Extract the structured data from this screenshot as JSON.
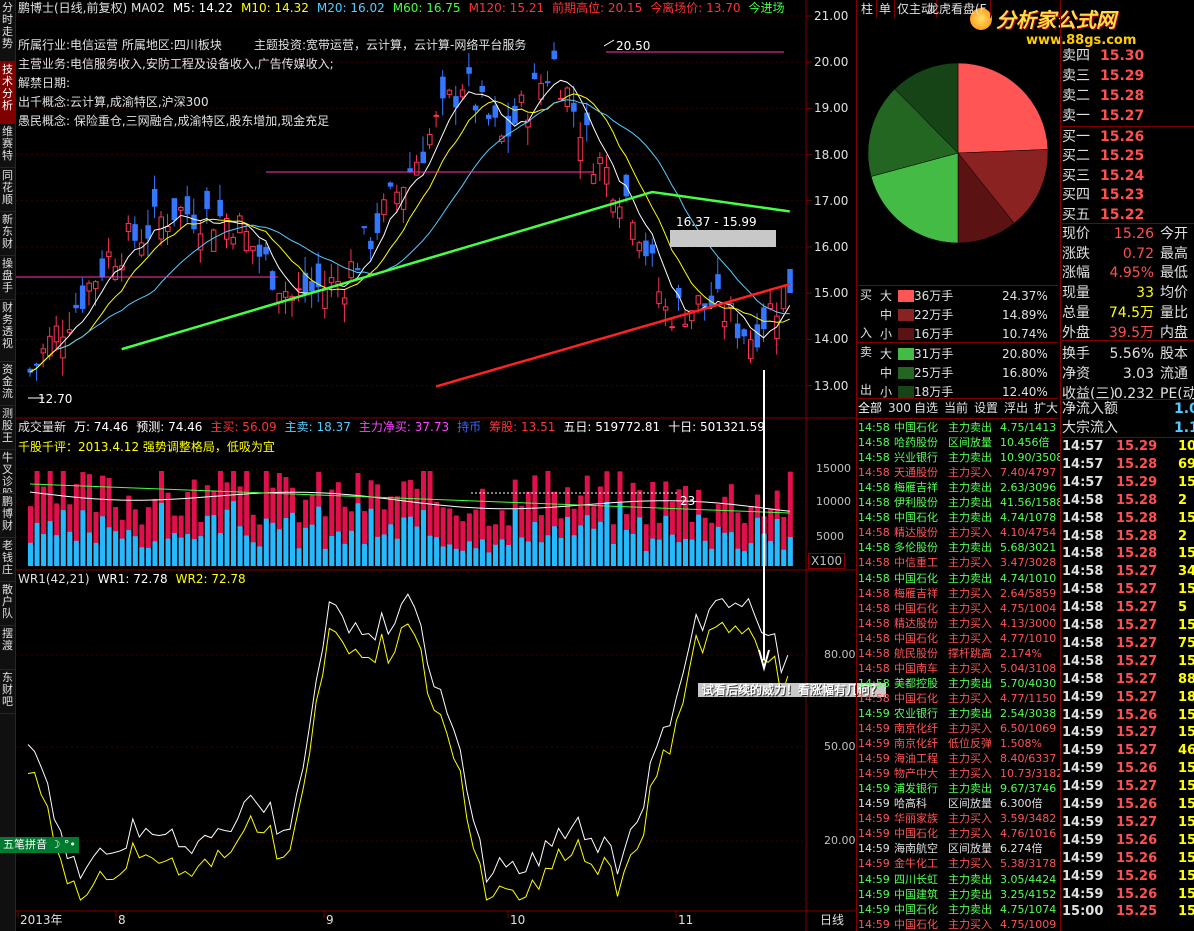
{
  "title_bar": {
    "items": [
      {
        "text": "鹏博士(日线,前复权) MA02",
        "color": "#e0e0e0"
      },
      {
        "text": "M5: 14.22",
        "color": "#ffffff"
      },
      {
        "text": "M10: 14.32",
        "color": "#ffff00"
      },
      {
        "text": "M20: 16.02",
        "color": "#55ccff"
      },
      {
        "text": "M60: 16.75",
        "color": "#44ff44"
      },
      {
        "text": "M120: 15.21",
        "color": "#ff3333"
      },
      {
        "text": "前期高位: 20.15",
        "color": "#ff3333"
      },
      {
        "text": "今离场价: 13.70",
        "color": "#ff3333"
      },
      {
        "text": "今进场",
        "color": "#44ff44"
      }
    ]
  },
  "info_lines": [
    "所属行业:电信运营 所属地区:四川板块",
    "主题投资:宽带运营，云计算，云计算-网络平台服务",
    "主营业务:电信服务收入,安防工程及设备收入,广告传媒收入;",
    "解禁日期:",
    "出千概念:云计算,成渝特区,沪深300",
    "愚民概念: 保险重仓,三网融合,成渝特区,股东增加,现金充足"
  ],
  "left_tabs": [
    "分时走势",
    "技术分析",
    "维赛特",
    "同花顺",
    "新东财",
    "操盘手",
    "财务透视",
    "资金流",
    "测股王",
    "牛叉诊股",
    "鹏博财",
    "老钱庄",
    "散户队",
    "摆渡",
    "东财吧"
  ],
  "price_axis": [
    "21.00",
    "20.00",
    "19.00",
    "18.00",
    "17.00",
    "16.00",
    "15.00",
    "14.00",
    "13.00"
  ],
  "price_annotations": {
    "high": "20.50",
    "low": "12.70",
    "range": "16.37 - 15.99"
  },
  "volume_title": [
    {
      "text": "成交量新",
      "color": "#e0e0e0"
    },
    {
      "text": "万: 74.46",
      "color": "#ffffff"
    },
    {
      "text": "预测: 74.46",
      "color": "#ffffff"
    },
    {
      "text": "主买: 56.09",
      "color": "#ff3333"
    },
    {
      "text": "主卖: 18.37",
      "color": "#55ccff"
    },
    {
      "text": "主力净买: 37.73",
      "color": "#ff44ff"
    },
    {
      "text": "持币",
      "color": "#3366ff"
    },
    {
      "text": "筹股: 13.51",
      "color": "#ff3333"
    },
    {
      "text": "五日: 519772.81",
      "color": "#ffffff"
    },
    {
      "text": "十日: 501321.59",
      "color": "#ffffff"
    }
  ],
  "volume_comment": "千股千评：2013.4.12 强势调整格局，低吸为宜",
  "volume_axis": [
    "15000",
    "10000",
    "5000"
  ],
  "volume_unit": "X100",
  "volume_marker": "23",
  "wr_title": [
    {
      "text": "WR1(42,21)",
      "color": "#e0e0e0"
    },
    {
      "text": "WR1: 72.78",
      "color": "#ffffff"
    },
    {
      "text": "WR2: 72.78",
      "color": "#ffff00"
    }
  ],
  "wr_axis": [
    "80.00",
    "50.00",
    "20.00"
  ],
  "annotation_text": "试看后续的威力！看涨幅有几何？",
  "ime_label": "五笔拼音",
  "x_axis": [
    "2013年",
    "8",
    "9",
    "10",
    "11"
  ],
  "period": "日线",
  "watermark": {
    "brand": "分析家公式网",
    "url": "www.88gs.com"
  },
  "right_tabs": [
    "柱",
    "单",
    "仅主动",
    "龙虎看盘(F"
  ],
  "pie": {
    "segments": [
      {
        "label": "买大",
        "value": 24.37,
        "color": "#ff5555"
      },
      {
        "label": "买中",
        "value": 14.89,
        "color": "#8b2222"
      },
      {
        "label": "买小",
        "value": 10.74,
        "color": "#5a1212"
      },
      {
        "label": "卖大",
        "value": 20.8,
        "color": "#44bb44"
      },
      {
        "label": "卖中",
        "value": 16.8,
        "color": "#226622"
      },
      {
        "label": "卖小",
        "value": 12.4,
        "color": "#174417"
      }
    ]
  },
  "flow_table": {
    "buy_label": [
      "买",
      "入"
    ],
    "sell_label": [
      "卖",
      "出"
    ],
    "rows": [
      {
        "size": "大",
        "amount": "36万手",
        "pct": "24.37%",
        "color": "#ff5555"
      },
      {
        "size": "中",
        "amount": "22万手",
        "pct": "14.89%",
        "color": "#8b2222"
      },
      {
        "size": "小",
        "amount": "16万手",
        "pct": "10.74%",
        "color": "#5a1212"
      },
      {
        "size": "大",
        "amount": "31万手",
        "pct": "20.80%",
        "color": "#44bb44"
      },
      {
        "size": "中",
        "amount": "25万手",
        "pct": "16.80%",
        "color": "#226622"
      },
      {
        "size": "小",
        "amount": "18万手",
        "pct": "12.40%",
        "color": "#174417"
      }
    ]
  },
  "bottom_tabs": [
    "全部",
    "300",
    "自选",
    "当前",
    "设置",
    "浮出",
    "扩大"
  ],
  "order_book": {
    "asks": [
      {
        "label": "卖四",
        "price": "15.30",
        "vol": ""
      },
      {
        "label": "卖三",
        "price": "15.29",
        "vol": ""
      },
      {
        "label": "卖二",
        "price": "15.28",
        "vol": ""
      },
      {
        "label": "卖一",
        "price": "15.27",
        "vol": ""
      }
    ],
    "bids": [
      {
        "label": "买一",
        "price": "15.26",
        "vol": ""
      },
      {
        "label": "买二",
        "price": "15.25",
        "vol": ""
      },
      {
        "label": "买三",
        "price": "15.24",
        "vol": ""
      },
      {
        "label": "买四",
        "price": "15.23",
        "vol": ""
      },
      {
        "label": "买五",
        "price": "15.22",
        "vol": ""
      }
    ]
  },
  "quote": [
    {
      "l": "现价",
      "v": "15.26",
      "vc": "#ff5050",
      "l2": "今开"
    },
    {
      "l": "涨跌",
      "v": "0.72",
      "vc": "#ff5050",
      "l2": "最高"
    },
    {
      "l": "涨幅",
      "v": "4.95%",
      "vc": "#ff5050",
      "l2": "最低"
    },
    {
      "l": "现量",
      "v": "33",
      "vc": "#ffff00",
      "l2": "均价"
    },
    {
      "l": "总量",
      "v": "74.5万",
      "vc": "#ffff00",
      "l2": "量比"
    },
    {
      "l": "外盘",
      "v": "39.5万",
      "vc": "#ff5050",
      "l2": "内盘"
    },
    {
      "l": "换手",
      "v": "5.56%",
      "vc": "#e0e0e0",
      "l2": "股本"
    },
    {
      "l": "净资",
      "v": "3.03",
      "vc": "#e0e0e0",
      "l2": "流通"
    },
    {
      "l": "收益(三)",
      "v": "0.232",
      "vc": "#e0e0e0",
      "l2": "PE(动"
    }
  ],
  "fund_flow": [
    {
      "label": "净流入额",
      "value": "1.0",
      "color": "#55ccff"
    },
    {
      "label": "大宗流入",
      "value": "1.1",
      "color": "#55ccff"
    }
  ],
  "ticker": [
    {
      "t": "14:58",
      "name": "中国石化",
      "act": "主力卖出",
      "num": "4.75/1413",
      "c": "#55ff55"
    },
    {
      "t": "14:58",
      "name": "哈药股份",
      "act": "区间放量",
      "num": "10.456倍",
      "c": "#55ff55"
    },
    {
      "t": "14:58",
      "name": "兴业银行",
      "act": "主力卖出",
      "num": "10.90/3508",
      "c": "#55ff55"
    },
    {
      "t": "14:58",
      "name": "天通股份",
      "act": "主力买入",
      "num": "7.40/4797",
      "c": "#ff5555"
    },
    {
      "t": "14:58",
      "name": "梅雁吉祥",
      "act": "主力卖出",
      "num": "2.63/3096",
      "c": "#55ff55"
    },
    {
      "t": "14:58",
      "name": "伊利股份",
      "act": "主力卖出",
      "num": "41.56/1588",
      "c": "#55ff55"
    },
    {
      "t": "14:58",
      "name": "中国石化",
      "act": "主力卖出",
      "num": "4.74/1078",
      "c": "#55ff55"
    },
    {
      "t": "14:58",
      "name": "精达股份",
      "act": "主力买入",
      "num": "4.10/4754",
      "c": "#ff5555"
    },
    {
      "t": "14:58",
      "name": "多伦股份",
      "act": "主力卖出",
      "num": "5.68/3021",
      "c": "#55ff55"
    },
    {
      "t": "14:58",
      "name": "中信重工",
      "act": "主力买入",
      "num": "3.47/3028",
      "c": "#ff5555"
    },
    {
      "t": "14:58",
      "name": "中国石化",
      "act": "主力卖出",
      "num": "4.74/1010",
      "c": "#55ff55"
    },
    {
      "t": "14:58",
      "name": "梅雁吉祥",
      "act": "主力买入",
      "num": "2.64/5859",
      "c": "#ff5555"
    },
    {
      "t": "14:58",
      "name": "中国石化",
      "act": "主力买入",
      "num": "4.75/1004",
      "c": "#ff5555"
    },
    {
      "t": "14:58",
      "name": "精达股份",
      "act": "主力买入",
      "num": "4.13/3000",
      "c": "#ff5555"
    },
    {
      "t": "14:58",
      "name": "中国石化",
      "act": "主力买入",
      "num": "4.77/1010",
      "c": "#ff5555"
    },
    {
      "t": "14:58",
      "name": "航民股份",
      "act": "撑杆跳高",
      "num": "2.174%",
      "c": "#ff5555"
    },
    {
      "t": "14:58",
      "name": "中国南车",
      "act": "主力买入",
      "num": "5.04/3108",
      "c": "#ff5555"
    },
    {
      "t": "14:58",
      "name": "美都控股",
      "act": "主力卖出",
      "num": "5.70/4030",
      "c": "#55ff55"
    },
    {
      "t": "14:58",
      "name": "中国石化",
      "act": "主力买入",
      "num": "4.77/1150",
      "c": "#ff5555"
    },
    {
      "t": "14:59",
      "name": "农业银行",
      "act": "主力卖出",
      "num": "2.54/3038",
      "c": "#55ff55"
    },
    {
      "t": "14:59",
      "name": "南京化纤",
      "act": "主力买入",
      "num": "6.50/1069",
      "c": "#ff5555"
    },
    {
      "t": "14:59",
      "name": "南京化纤",
      "act": "低位反弹",
      "num": "1.508%",
      "c": "#ff5555"
    },
    {
      "t": "14:59",
      "name": "海油工程",
      "act": "主力买入",
      "num": "8.40/6337",
      "c": "#ff5555"
    },
    {
      "t": "14:59",
      "name": "物产中大",
      "act": "主力买入",
      "num": "10.73/3182",
      "c": "#ff5555"
    },
    {
      "t": "14:59",
      "name": "浦发银行",
      "act": "主力卖出",
      "num": "9.67/3746",
      "c": "#55ff55"
    },
    {
      "t": "14:59",
      "name": "哈高科",
      "act": "区间放量",
      "num": "6.300倍",
      "c": "#e0e0e0"
    },
    {
      "t": "14:59",
      "name": "华丽家族",
      "act": "主力买入",
      "num": "3.59/3482",
      "c": "#ff5555"
    },
    {
      "t": "14:59",
      "name": "中国石化",
      "act": "主力买入",
      "num": "4.76/1016",
      "c": "#ff5555"
    },
    {
      "t": "14:59",
      "name": "海南航空",
      "act": "区间放量",
      "num": "6.274倍",
      "c": "#e0e0e0"
    },
    {
      "t": "14:59",
      "name": "金牛化工",
      "act": "主力买入",
      "num": "5.38/3178",
      "c": "#ff5555"
    },
    {
      "t": "14:59",
      "name": "四川长虹",
      "act": "主力卖出",
      "num": "3.05/4424",
      "c": "#55ff55"
    },
    {
      "t": "14:59",
      "name": "中国建筑",
      "act": "主力卖出",
      "num": "3.25/4152",
      "c": "#55ff55"
    },
    {
      "t": "14:59",
      "name": "中国石化",
      "act": "主力卖出",
      "num": "4.75/1074",
      "c": "#55ff55"
    },
    {
      "t": "14:59",
      "name": "中国石化",
      "act": "主力买入",
      "num": "4.75/1009",
      "c": "#ff5555"
    }
  ],
  "trades": [
    {
      "t": "14:57",
      "p": "15.29",
      "v": "10",
      "c": "#ff5050"
    },
    {
      "t": "14:57",
      "p": "15.28",
      "v": "69",
      "c": "#ff5050"
    },
    {
      "t": "14:57",
      "p": "15.29",
      "v": "15",
      "c": "#ff5050"
    },
    {
      "t": "14:58",
      "p": "15.28",
      "v": "2",
      "c": "#ff5050"
    },
    {
      "t": "14:58",
      "p": "15.28",
      "v": "15",
      "c": "#ff5050"
    },
    {
      "t": "14:58",
      "p": "15.28",
      "v": "2",
      "c": "#ff5050"
    },
    {
      "t": "14:58",
      "p": "15.28",
      "v": "15",
      "c": "#ff5050"
    },
    {
      "t": "14:58",
      "p": "15.27",
      "v": "34",
      "c": "#ff5050"
    },
    {
      "t": "14:58",
      "p": "15.27",
      "v": "15",
      "c": "#ff5050"
    },
    {
      "t": "14:58",
      "p": "15.27",
      "v": "5",
      "c": "#ff5050"
    },
    {
      "t": "14:58",
      "p": "15.27",
      "v": "15",
      "c": "#ff5050"
    },
    {
      "t": "14:58",
      "p": "15.27",
      "v": "75",
      "c": "#ff5050"
    },
    {
      "t": "14:58",
      "p": "15.27",
      "v": "15",
      "c": "#ff5050"
    },
    {
      "t": "14:58",
      "p": "15.27",
      "v": "88",
      "c": "#ff5050"
    },
    {
      "t": "14:59",
      "p": "15.27",
      "v": "18",
      "c": "#ff5050"
    },
    {
      "t": "14:59",
      "p": "15.26",
      "v": "15",
      "c": "#ff5050"
    },
    {
      "t": "14:59",
      "p": "15.27",
      "v": "15",
      "c": "#ff5050"
    },
    {
      "t": "14:59",
      "p": "15.27",
      "v": "46",
      "c": "#ff5050"
    },
    {
      "t": "14:59",
      "p": "15.26",
      "v": "15",
      "c": "#ff5050"
    },
    {
      "t": "14:59",
      "p": "15.27",
      "v": "15",
      "c": "#ff5050"
    },
    {
      "t": "14:59",
      "p": "15.26",
      "v": "15",
      "c": "#ff5050"
    },
    {
      "t": "14:59",
      "p": "15.27",
      "v": "15",
      "c": "#ff5050"
    },
    {
      "t": "14:59",
      "p": "15.26",
      "v": "15",
      "c": "#ff5050"
    },
    {
      "t": "14:59",
      "p": "15.26",
      "v": "15",
      "c": "#ff5050"
    },
    {
      "t": "14:59",
      "p": "15.26",
      "v": "15",
      "c": "#ff5050"
    },
    {
      "t": "14:59",
      "p": "15.26",
      "v": "15",
      "c": "#ff5050"
    },
    {
      "t": "15:00",
      "p": "15.25",
      "v": "15",
      "c": "#ff5050"
    }
  ]
}
